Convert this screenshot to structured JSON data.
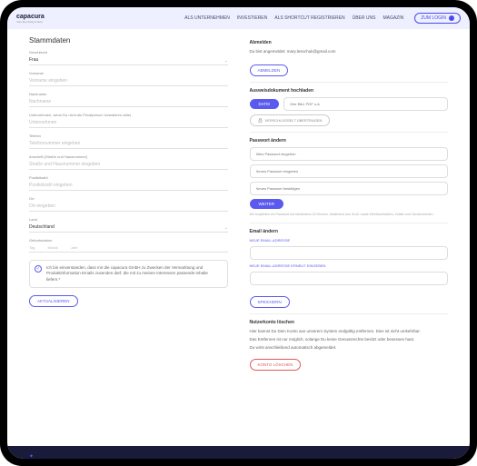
{
  "brand": {
    "name": "capacura",
    "tagline": "Your key thing is here"
  },
  "nav": {
    "item1": "ALS UNTERNEHMEN",
    "item2": "INVESTIEREN",
    "item3": "ALS SHORTCUT REGISTRIEREN",
    "item4": "ÜBER UNS",
    "item5": "MAGAZIN",
    "login": "ZUM LOGIN"
  },
  "left": {
    "title": "Stammdaten",
    "gender": {
      "label": "Geschlecht",
      "value": "Frau"
    },
    "firstname": {
      "label": "Vorname",
      "placeholder": "Vorname eingeben"
    },
    "lastname": {
      "label": "Nachname",
      "placeholder": "Nachname"
    },
    "company": {
      "label": "Unternehmen, wenn Du nicht als Privatperson investieren willst",
      "placeholder": "Unternehmen"
    },
    "phone": {
      "label": "Telefon",
      "placeholder": "Telefonnummer eingeben"
    },
    "address": {
      "label": "Anschrift (Straße und Hausnummer)",
      "placeholder": "Straße und Hausnummer eingeben"
    },
    "zip": {
      "label": "Postleitzahl",
      "placeholder": "Postleitzahl eingeben"
    },
    "city": {
      "label": "Ort",
      "placeholder": "Ort eingeben"
    },
    "country": {
      "label": "Land",
      "value": "Deutschland"
    },
    "dob": {
      "label": "Geburtsdatum",
      "day": "Tag",
      "month": "Monat",
      "year": "Jahr"
    },
    "consent": "Ich bin einverstanden, dass mir die capacura GmbH zu Zwecken der Vermarktung und Produktinformation Emails zusenden darf, die mit zu meinen Interessen passende Inhalte liefern.*",
    "update": "AKTUALISIEREN"
  },
  "right": {
    "logout_title": "Abmelden",
    "logged_in": "Du bist angemeldet: mary.lesnchuk@gmail.com",
    "logout_btn": "ABMELDEN",
    "upload_title": "Ausweisdokument hochladen",
    "file_btn": "DATEI",
    "file_text": "Hier Bild, PDF o.ä.",
    "encrypt": "VERSCHLÜSSELT ÜBERTRAGEN",
    "pw_title": "Passwort ändern",
    "pw_old": "Altes Passwort eingeben",
    "pw_new": "Neues Passwort eingeben",
    "pw_confirm": "Neues Passwort bestätigen",
    "pw_hint": "Wir empfehlen ein Passwort mit mindestens 16 Zeichen, bestehend aus Groß- sowie Kleinbuchstaben, Zahlen und Sonderzeichen.",
    "pw_btn": "WEITER",
    "email_title": "Email ändern",
    "email_new": "NEUE EMAIL-ADRESSE",
    "email_confirm": "NEUE EMAIL-ADRESSE ERNEUT EINGEBEN",
    "email_btn": "SPEICHERN",
    "delete_title": "Nutzerkonto löschen",
    "delete_text1": "Hier kannst Du Dein Konto aus unserem System endgültig entfernen. Dies ist nicht umkehrbar.",
    "delete_text2": "Das Entfernen ist nur möglich, solange Du keine Genussrechte besitzt oder besessen hast.",
    "delete_text3": "Du wirst anschließend automatisch abgemeldet.",
    "delete_btn": "KONTO LÖSCHEN"
  }
}
